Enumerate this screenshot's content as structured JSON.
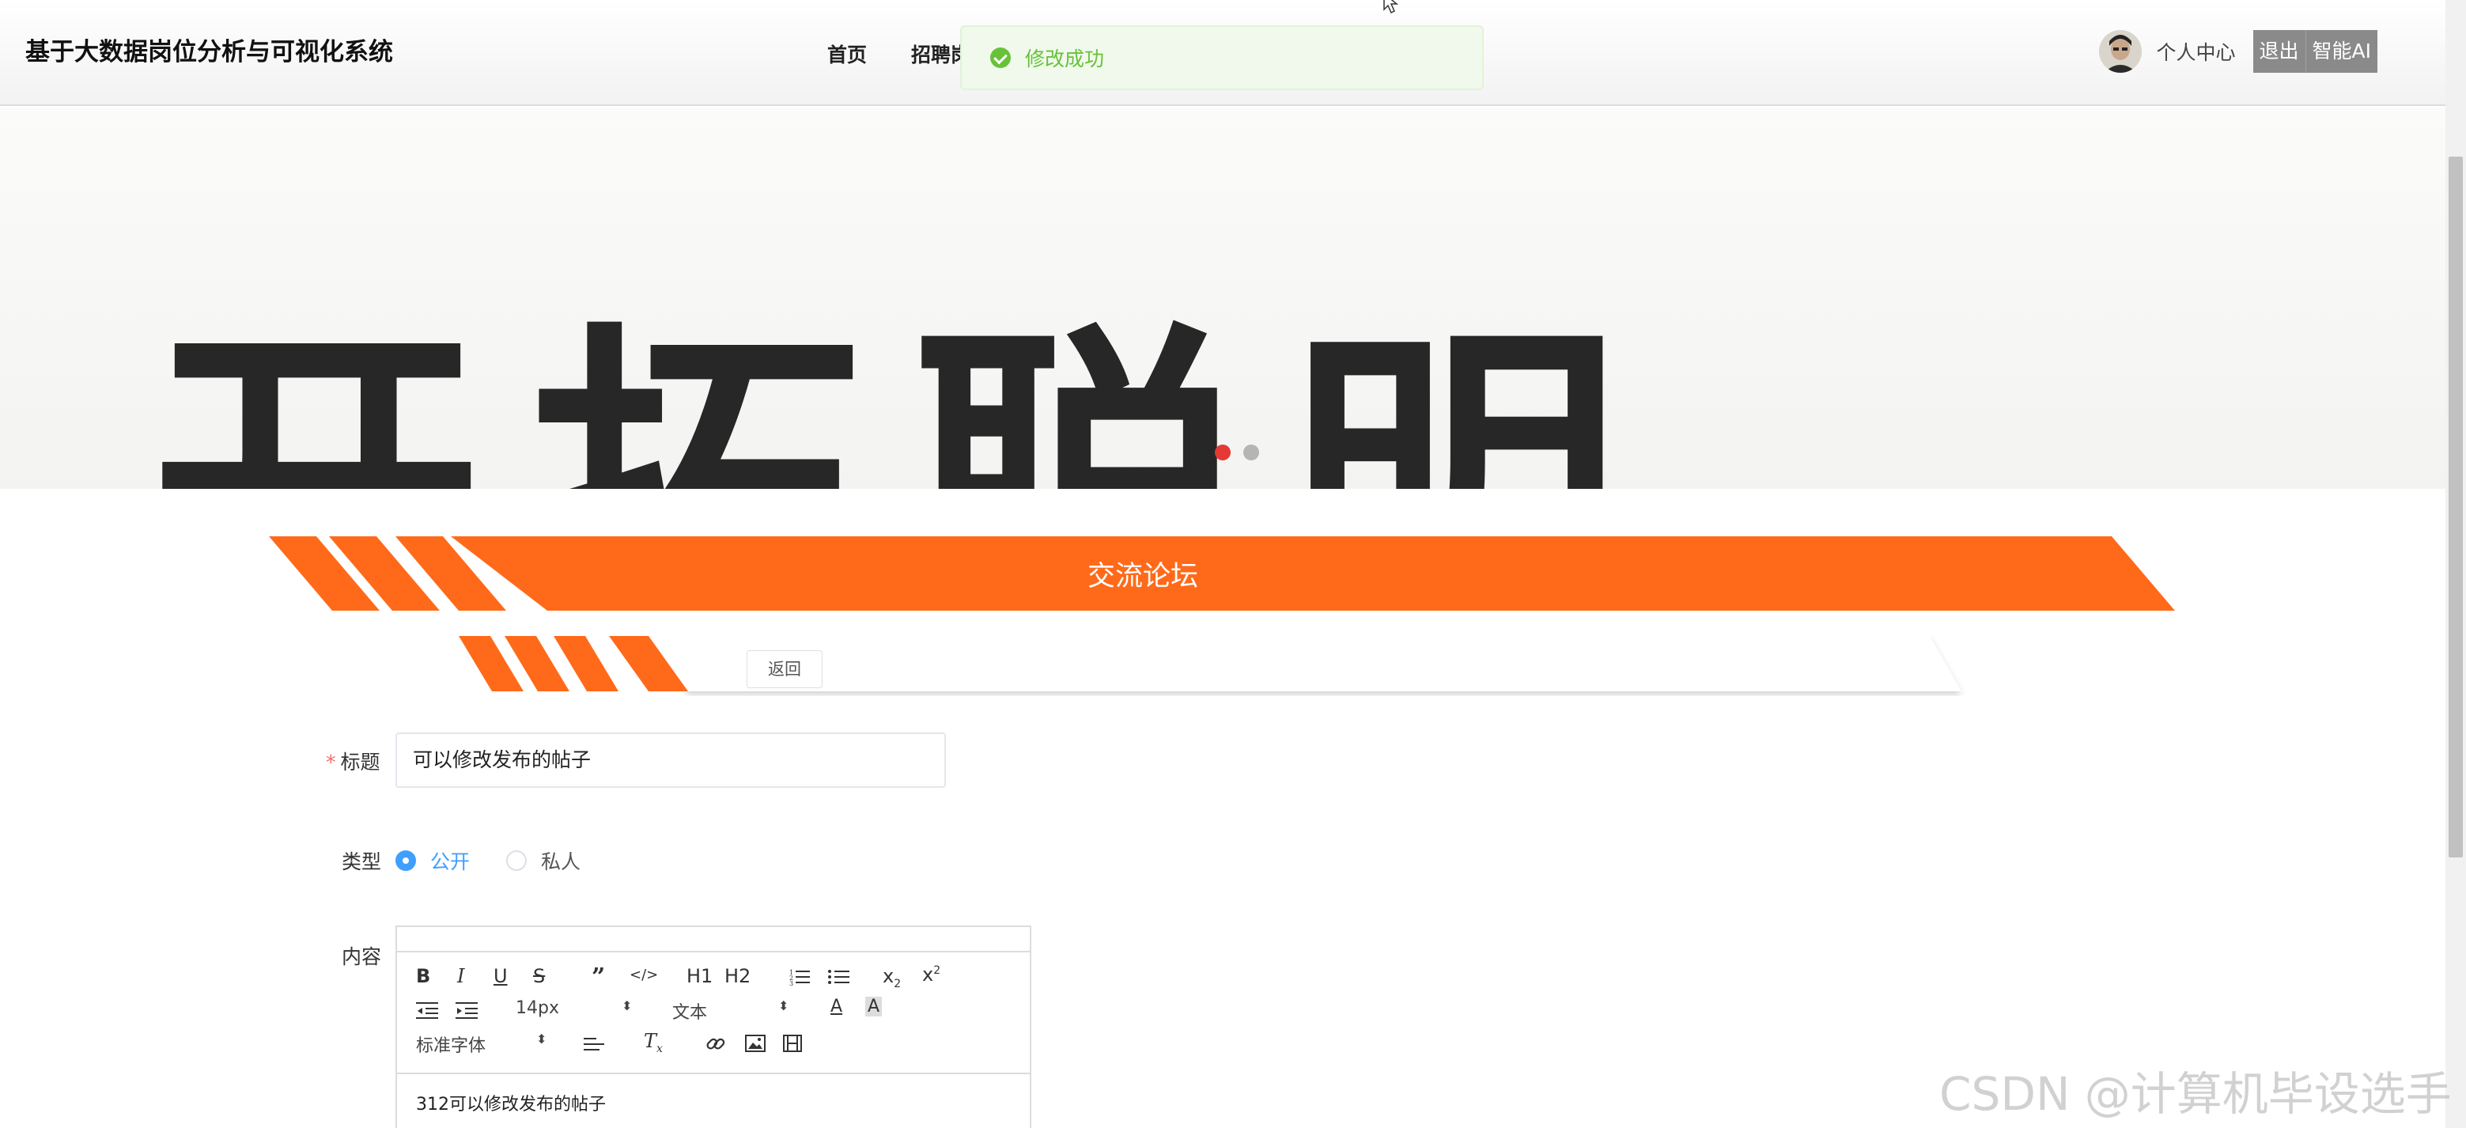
{
  "header": {
    "app_title": "基于大数据岗位分析与可视化系统",
    "nav": [
      "首页",
      "招聘岗"
    ],
    "profile_label": "个人中心",
    "logout_label": "退出",
    "ai_label": "智能AI"
  },
  "toast": {
    "message": "修改成功",
    "type": "success"
  },
  "banner": {
    "image_text": "开拓聪明",
    "active_slide": 1,
    "slide_count": 2
  },
  "section": {
    "title": "交流论坛",
    "back_label": "返回"
  },
  "form": {
    "title_label": "标题",
    "title_value": "可以修改发布的帖子",
    "type_label": "类型",
    "type_options": [
      "公开",
      "私人"
    ],
    "type_selected": "公开",
    "content_label": "内容",
    "content_value": "312可以修改发布的帖子"
  },
  "editor_toolbar": {
    "font_size": "14px",
    "header_select": "文本",
    "font_family": "标准字体",
    "h1": "H1",
    "h2": "H2"
  },
  "watermark": "CSDN @计算机毕设选手",
  "colors": {
    "accent_orange": "#ff6a1a",
    "success_green": "#67c23a",
    "primary_blue": "#409eff",
    "required_red": "#f56c6c"
  }
}
